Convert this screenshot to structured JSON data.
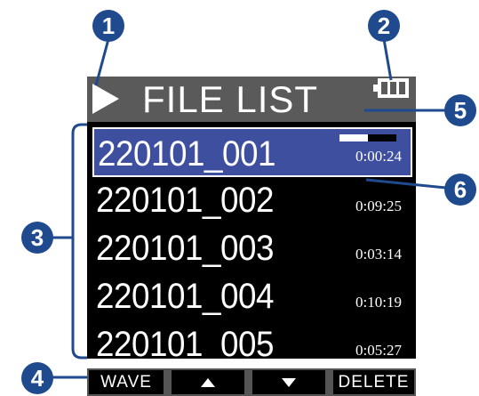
{
  "header": {
    "title": "FILE LIST",
    "play_icon": "play-icon",
    "battery_icon": "battery-icon"
  },
  "files": [
    {
      "name": "220101_001",
      "time": "0:00:24",
      "selected": true
    },
    {
      "name": "220101_002",
      "time": "0:09:25",
      "selected": false
    },
    {
      "name": "220101_003",
      "time": "0:03:14",
      "selected": false
    },
    {
      "name": "220101_004",
      "time": "0:10:19",
      "selected": false
    },
    {
      "name": "220101_005",
      "time": "0:05:27",
      "selected": false
    }
  ],
  "playback_progress": 0.5,
  "footer": {
    "wave_label": "WAVE",
    "up_icon": "up-arrow-icon",
    "down_icon": "down-arrow-icon",
    "delete_label": "DELETE"
  },
  "callouts": [
    "1",
    "2",
    "3",
    "4",
    "5",
    "6"
  ],
  "colors": {
    "callout": "#1f4b8e",
    "selected_row": "#3f4fa0",
    "header_bg": "#5a5a5a"
  }
}
